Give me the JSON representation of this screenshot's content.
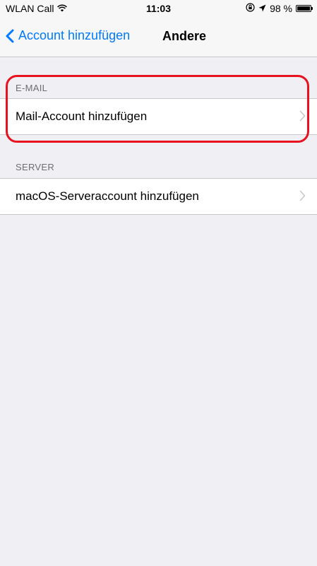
{
  "status_bar": {
    "carrier": "WLAN Call",
    "time": "11:03",
    "battery": "98 %",
    "battery_level": 0.98
  },
  "nav": {
    "back_label": "Account hinzufügen",
    "title": "Andere"
  },
  "sections": {
    "email": {
      "header": "E-MAIL",
      "items": [
        {
          "label": "Mail-Account hinzufügen"
        }
      ]
    },
    "server": {
      "header": "SERVER",
      "items": [
        {
          "label": "macOS-Serveraccount hinzufügen"
        }
      ]
    }
  },
  "annotation": {
    "color": "#e8121e"
  }
}
